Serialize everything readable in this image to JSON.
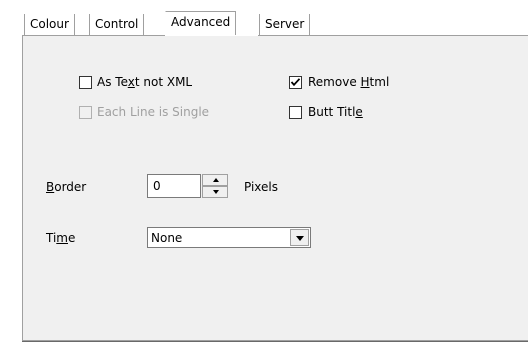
{
  "tabs": [
    {
      "label": "Colour",
      "selected": false
    },
    {
      "label": "Control",
      "selected": false
    },
    {
      "label": "Advanced",
      "selected": true
    },
    {
      "label": "Server",
      "selected": false
    }
  ],
  "options": {
    "as_text_not_xml": {
      "pre": "As Te",
      "accel": "x",
      "post": "t not XML",
      "checked": false,
      "enabled": true
    },
    "each_line_is_single": {
      "label": "Each Line is Single",
      "checked": false,
      "enabled": false
    },
    "remove_html": {
      "pre": "Remove ",
      "accel": "H",
      "post": "tml",
      "checked": true,
      "enabled": true
    },
    "butt_title": {
      "pre": "Butt Titl",
      "accel": "e",
      "post": "",
      "checked": false,
      "enabled": true
    }
  },
  "border": {
    "label_accel": "B",
    "label_rest": "order",
    "value": "0",
    "unit": "Pixels"
  },
  "time": {
    "label_pre": "Ti",
    "label_accel": "m",
    "label_post": "e",
    "selected": "None"
  },
  "colors": {
    "panel": "#f0f0f0",
    "border": "#a0a0a0",
    "disabled_text": "#a0a0a0"
  }
}
